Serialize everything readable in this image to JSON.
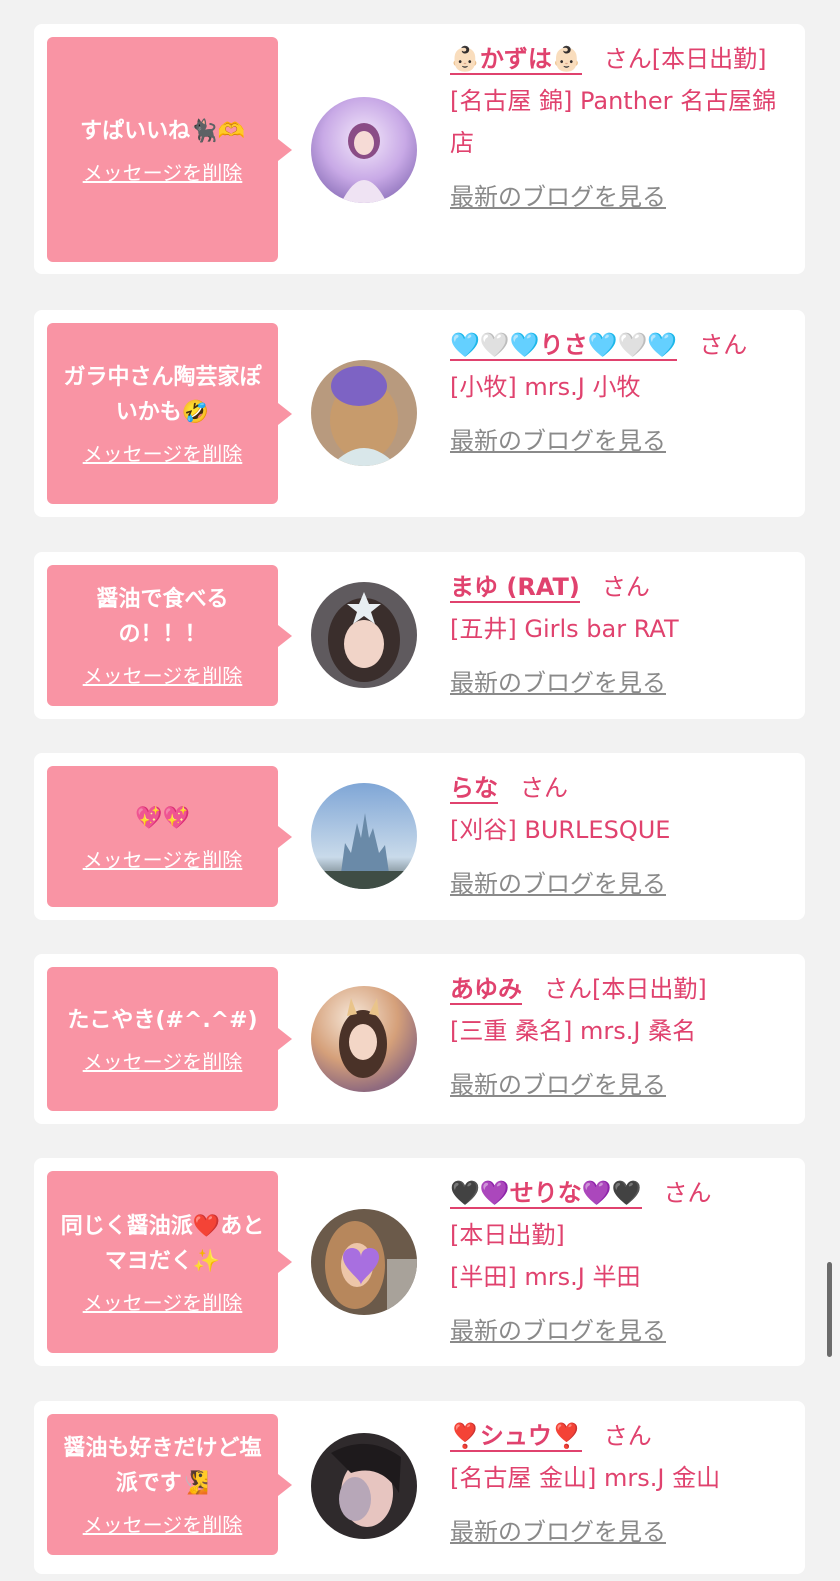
{
  "delete_label": "メッセージを削除",
  "san_label": "さん",
  "blog_label": "最新のブログを見る",
  "colors": {
    "accent": "#e0426e",
    "bubble": "#f994a4",
    "link_gray": "#8a8a8a",
    "background": "#f2f2f2"
  },
  "cards": [
    {
      "message": "すぱいいね🐈‍⬛🫶",
      "name": "👶🏻かずは👶🏻",
      "status": "[本日出勤]",
      "shop": "[名古屋 錦] Panther 名古屋錦店"
    },
    {
      "message": "ガラ中さん陶芸家ぽいかも🤣",
      "name": "🩵🤍🩵りさ🩵🤍🩵",
      "status": "",
      "shop": "[小牧] mrs.J 小牧"
    },
    {
      "message": "醤油で食べるの！！！",
      "name": "まゆ (RAT)",
      "status": "",
      "shop": "[五井] Girls bar RAT"
    },
    {
      "message": "💖💖",
      "name": "らな",
      "status": "",
      "shop": "[刈谷] BURLESQUE"
    },
    {
      "message": "たこやき(#^.^#)",
      "name": "あゆみ",
      "status": "[本日出勤]",
      "shop": "[三重 桑名] mrs.J 桑名"
    },
    {
      "message": "同じく醤油派❤️あとマヨだく✨",
      "name": "🖤💜せりな💜🖤",
      "status": "[本日出勤]",
      "shop": "[半田] mrs.J 半田"
    },
    {
      "message": "醤油も好きだけど塩派です🧏",
      "name": "❣️シュウ❣️",
      "status": "",
      "shop": "[名古屋 金山] mrs.J 金山"
    }
  ]
}
